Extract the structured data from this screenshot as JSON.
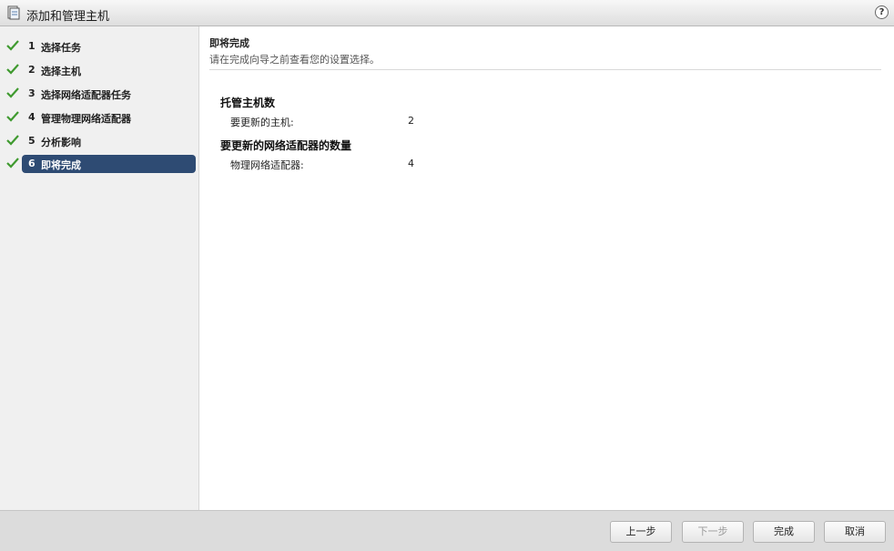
{
  "window": {
    "title": "添加和管理主机",
    "help_label": "?"
  },
  "steps": [
    {
      "num": "1",
      "label": "选择任务",
      "done": true
    },
    {
      "num": "2",
      "label": "选择主机",
      "done": true
    },
    {
      "num": "3",
      "label": "选择网络适配器任务",
      "done": true
    },
    {
      "num": "4",
      "label": "管理物理网络适配器",
      "done": true
    },
    {
      "num": "5",
      "label": "分析影响",
      "done": true
    },
    {
      "num": "6",
      "label": "即将完成",
      "done": true,
      "active": true
    }
  ],
  "main": {
    "title": "即将完成",
    "subtitle": "请在完成向导之前查看您的设置选择。",
    "sections": [
      {
        "heading": "托管主机数",
        "rows": [
          {
            "label": "要更新的主机:",
            "value": "2"
          }
        ]
      },
      {
        "heading": "要更新的网络适配器的数量",
        "rows": [
          {
            "label": "物理网络适配器:",
            "value": "4"
          }
        ]
      }
    ]
  },
  "footer": {
    "back": "上一步",
    "next": "下一步",
    "finish": "完成",
    "cancel": "取消"
  },
  "colors": {
    "active_step": "#2e4b73",
    "check": "#3f9a2f"
  }
}
